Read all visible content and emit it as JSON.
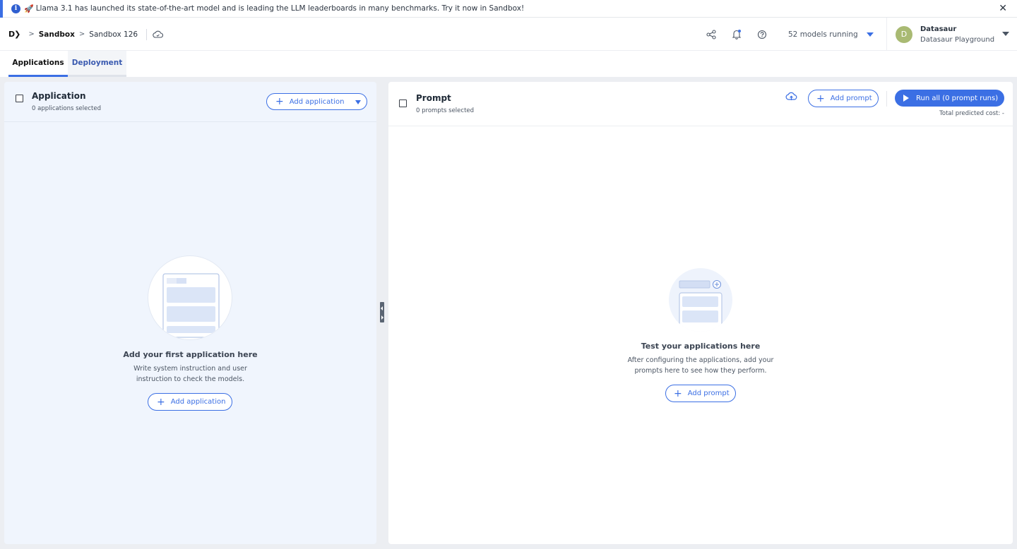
{
  "banner": {
    "text": "Llama 3.1 has launched its state-of-the-art model and is leading the LLM leaderboards in many benchmarks. Try it now in Sandbox!",
    "info_icon": "i",
    "rocket_icon": "🚀",
    "close_icon": "✕"
  },
  "header": {
    "logo": "D❯",
    "breadcrumb": [
      "Sandbox",
      "Sandbox 126"
    ],
    "separator": ">",
    "models_running": "52 models running",
    "user": {
      "initial": "D",
      "org": "Datasaur",
      "workspace": "Datasaur Playground"
    }
  },
  "tabs": [
    {
      "label": "Applications",
      "active": true
    },
    {
      "label": "Deployment",
      "active": false
    }
  ],
  "applications_panel": {
    "title": "Application",
    "selected_count_text": "0 applications selected",
    "add_button_label": "Add application",
    "empty_title": "Add your first application here",
    "empty_desc_line1": "Write system instruction and user",
    "empty_desc_line2": "instruction to check the models.",
    "empty_add_label": "Add application"
  },
  "prompt_panel": {
    "title": "Prompt",
    "selected_count_text": "0 prompts selected",
    "add_button_label": "Add prompt",
    "run_all_label": "Run all (0 prompt runs)",
    "cost_text": "Total predicted cost: -",
    "empty_title": "Test your applications here",
    "empty_desc_line1": "After configuring the applications, add your",
    "empty_desc_line2": "prompts here to see how they perform.",
    "empty_add_label": "Add prompt"
  },
  "colors": {
    "accent": "#3b6fe4",
    "left_panel_bg": "#f0f5fd",
    "avatar": "#a9ba73"
  }
}
